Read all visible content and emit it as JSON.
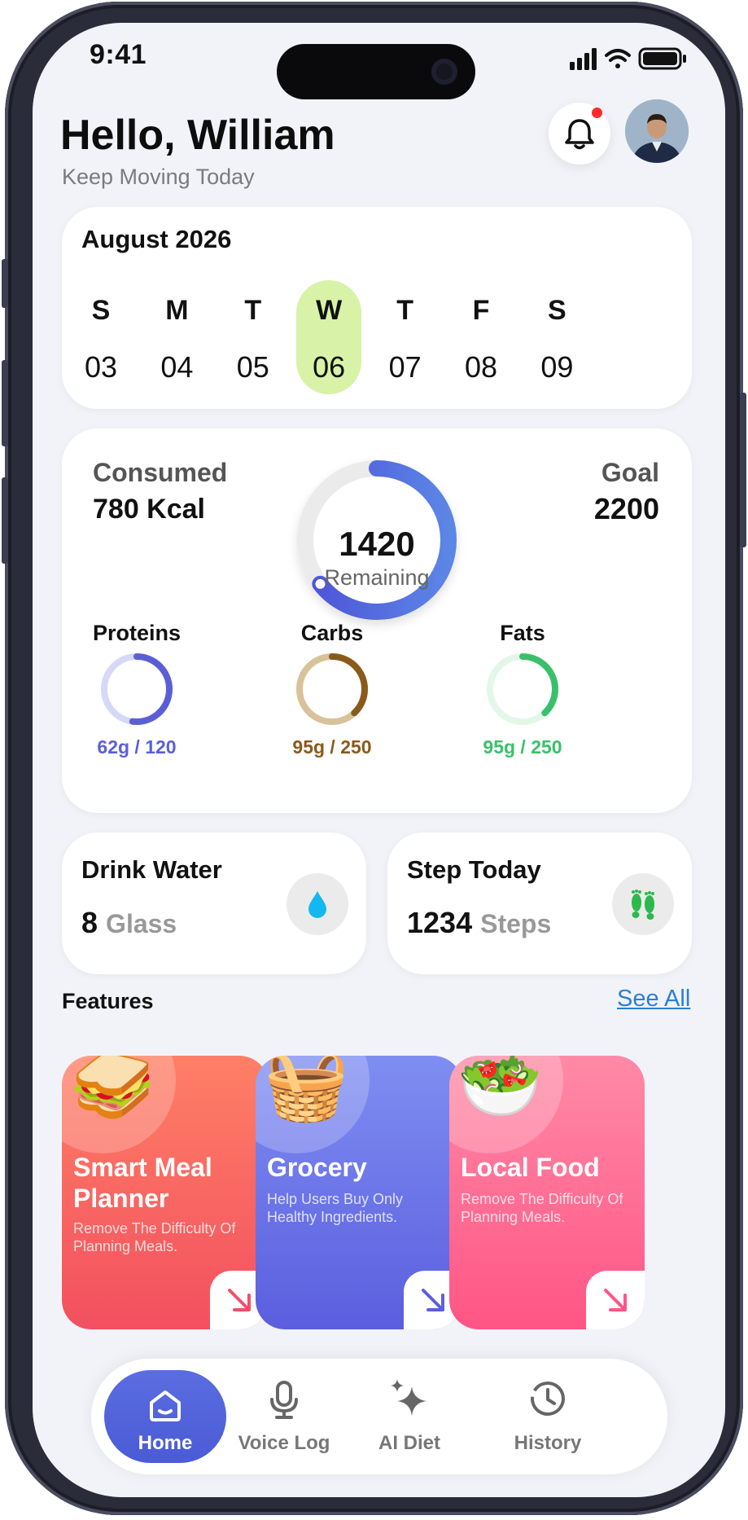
{
  "status_bar": {
    "time": "9:41"
  },
  "header": {
    "greeting": "Hello, William",
    "subtitle": "Keep Moving Today",
    "notification_dot_color": "#ff2a2a"
  },
  "calendar": {
    "month": "August 2026",
    "days": [
      {
        "letter": "S",
        "num": "03",
        "active": false
      },
      {
        "letter": "M",
        "num": "04",
        "active": false
      },
      {
        "letter": "T",
        "num": "05",
        "active": false
      },
      {
        "letter": "W",
        "num": "06",
        "active": true
      },
      {
        "letter": "T",
        "num": "07",
        "active": false
      },
      {
        "letter": "F",
        "num": "08",
        "active": false
      },
      {
        "letter": "S",
        "num": "09",
        "active": false
      }
    ],
    "active_color": "#d8f2a8"
  },
  "calories": {
    "consumed_label": "Consumed",
    "consumed_value": "780 Kcal",
    "goal_label": "Goal",
    "goal_value": "2200",
    "remaining_value": "1420",
    "remaining_label": "Remaining",
    "progress_fraction": 0.645,
    "ring_color": "#5060dc"
  },
  "macros": [
    {
      "title": "Proteins",
      "value": "62g / 120",
      "fraction": 0.52,
      "color": "#5a5fd6",
      "track": "#d6d8f8"
    },
    {
      "title": "Carbs",
      "value": "95g / 250",
      "fraction": 0.38,
      "color": "#8a5a1c",
      "track": "#d8c29a"
    },
    {
      "title": "Fats",
      "value": "95g / 250",
      "fraction": 0.38,
      "color": "#3ac06a",
      "track": "#e2f7e8"
    }
  ],
  "water": {
    "title": "Drink Water",
    "value": "8",
    "unit": "Glass",
    "icon": "water-drop-icon"
  },
  "steps": {
    "title": "Step Today",
    "value": "1234",
    "unit": "Steps",
    "icon": "footprints-icon"
  },
  "features": {
    "title": "Features",
    "see_all": "See All",
    "items": [
      {
        "title": "Smart Meal Planner",
        "desc": "Remove The Difficulty Of Planning Meals.",
        "icon": "sandwich-icon",
        "emoji": "🥪",
        "gradient": [
          "#ff7f66",
          "#f2505f"
        ],
        "arrow_color": "#f0506a"
      },
      {
        "title": "Grocery",
        "desc": "Help Users Buy Only Healthy Ingredients.",
        "icon": "grocery-basket-icon",
        "emoji": "🧺",
        "gradient": [
          "#7f8ef2",
          "#5b5ede"
        ],
        "arrow_color": "#5b5ede"
      },
      {
        "title": "Local Food",
        "desc": "Remove The Difficulty Of Planning Meals.",
        "icon": "salad-bowl-icon",
        "emoji": "🥗",
        "gradient": [
          "#ff8aa6",
          "#ff5585"
        ],
        "arrow_color": "#ff5585"
      }
    ]
  },
  "nav": {
    "items": [
      {
        "label": "Home",
        "icon": "home-icon",
        "active": true
      },
      {
        "label": "Voice Log",
        "icon": "microphone-icon",
        "active": false
      },
      {
        "label": "AI Diet",
        "icon": "sparkle-icon",
        "active": false
      },
      {
        "label": "History",
        "icon": "history-clock-icon",
        "active": false
      }
    ]
  }
}
